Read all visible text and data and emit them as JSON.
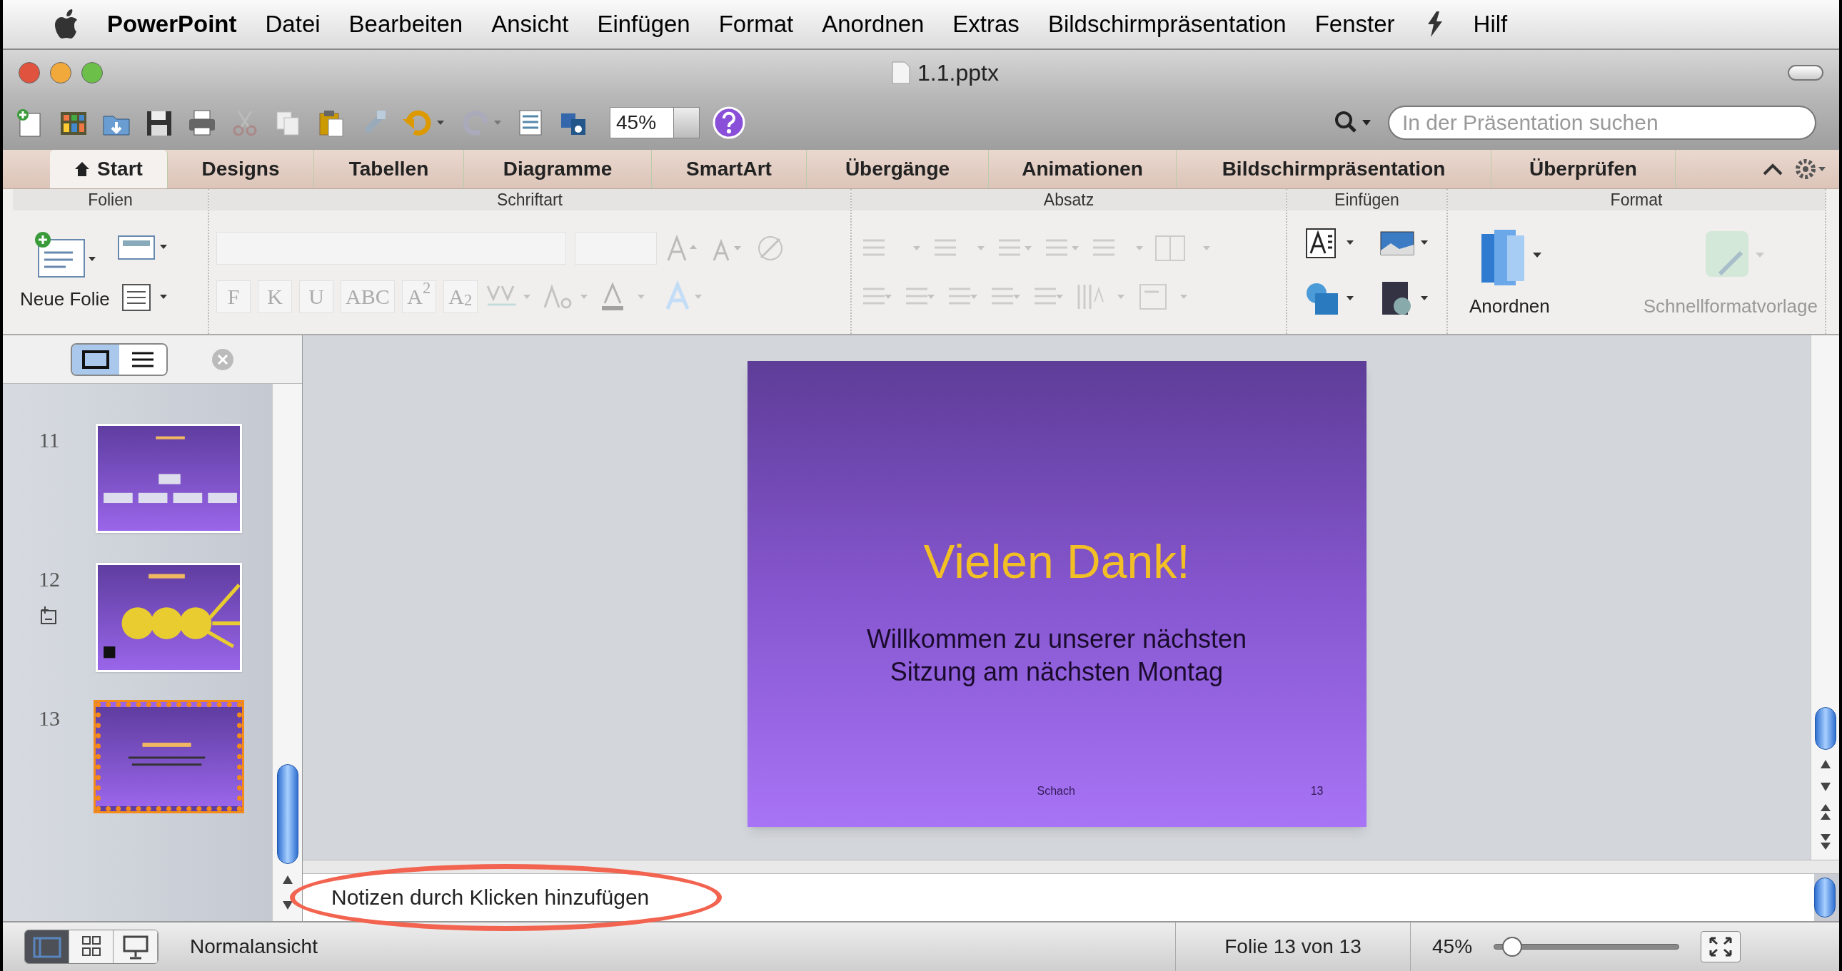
{
  "menu_bar": {
    "app": "PowerPoint",
    "items": [
      "Datei",
      "Bearbeiten",
      "Ansicht",
      "Einfügen",
      "Format",
      "Anordnen",
      "Extras",
      "Bildschirmpräsentation",
      "Fenster",
      "Hilf"
    ]
  },
  "window": {
    "title": "1.1.pptx"
  },
  "toolbar": {
    "zoom": "45%",
    "search": {
      "placeholder": "In der Präsentation suchen"
    }
  },
  "tabs": [
    {
      "label": "Start",
      "selected": true
    },
    {
      "label": "Designs",
      "selected": false
    },
    {
      "label": "Tabellen",
      "selected": false
    },
    {
      "label": "Diagramme",
      "selected": false
    },
    {
      "label": "SmartArt",
      "selected": false
    },
    {
      "label": "Übergänge",
      "selected": false
    },
    {
      "label": "Animationen",
      "selected": false
    },
    {
      "label": "Bildschirmpräsentation",
      "selected": false
    },
    {
      "label": "Überprüfen",
      "selected": false
    }
  ],
  "ribbon": {
    "groups": [
      "Folien",
      "Schriftart",
      "Absatz",
      "Einfügen",
      "Format"
    ],
    "new_slide": "Neue Folie",
    "font_buttons": [
      "F",
      "K",
      "U",
      "ABC",
      "A$^{2}$",
      "A$_{2}$"
    ],
    "arrange": "Anordnen",
    "quick_styles": "Schnellformatvorlage"
  },
  "slides": [
    {
      "number": "11",
      "selected": false,
      "animated": false,
      "kind": "orgchart"
    },
    {
      "number": "12",
      "selected": false,
      "animated": true,
      "kind": "circles"
    },
    {
      "number": "13",
      "selected": true,
      "animated": false,
      "kind": "text"
    }
  ],
  "current_slide": {
    "title": "Vielen Dank!",
    "subtitle_lines": [
      "Willkommen zu unserer nächsten",
      "Sitzung am nächsten Montag"
    ],
    "footer": "Schach",
    "page_number": "13"
  },
  "notes": {
    "placeholder": "Notizen durch Klicken hinzufügen"
  },
  "status_bar": {
    "views": [
      {
        "selected": true
      },
      {
        "selected": false
      },
      {
        "selected": false
      }
    ],
    "view_name": "Normalansicht",
    "slide_position": "Folie 13 von 13",
    "zoom": "45%",
    "zoom_slider": {
      "level": 0.1
    }
  }
}
